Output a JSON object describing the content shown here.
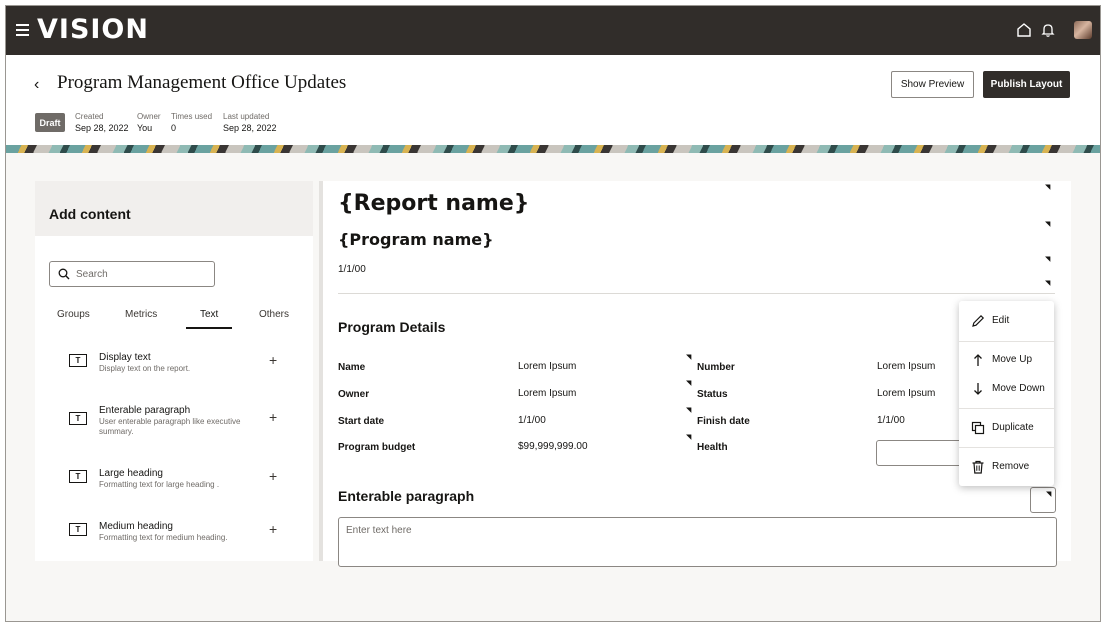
{
  "app": {
    "logo_text": "VISION"
  },
  "header": {
    "title": "Program Management Office Updates",
    "show_preview_label": "Show Preview",
    "publish_label": "Publish Layout",
    "status_badge": "Draft",
    "meta": [
      {
        "key": "Created",
        "value": "Sep 28, 2022"
      },
      {
        "key": "Owner",
        "value": "You"
      },
      {
        "key": "Times used",
        "value": "0"
      },
      {
        "key": "Last updated",
        "value": "Sep 28, 2022"
      }
    ]
  },
  "left_panel": {
    "title": "Add content",
    "search_placeholder": "Search",
    "tabs": [
      "Groups",
      "Metrics",
      "Text",
      "Others"
    ],
    "active_tab": "Text",
    "items": [
      {
        "title": "Display text",
        "desc": "Display text on the report."
      },
      {
        "title": "Enterable paragraph",
        "desc": "User enterable paragraph like executive summary."
      },
      {
        "title": "Large heading",
        "desc": "Formatting text for large heading ."
      },
      {
        "title": "Medium heading",
        "desc": "Formatting text for medium heading."
      }
    ]
  },
  "canvas": {
    "report_name": "{Report name}",
    "program_name": "{Program name}",
    "date": "1/1/00",
    "program_details_title": "Program Details",
    "fields": [
      {
        "label": "Name",
        "value": "Lorem Ipsum"
      },
      {
        "label": "Owner",
        "value": "Lorem Ipsum"
      },
      {
        "label": "Start date",
        "value": "1/1/00"
      },
      {
        "label": "Program budget",
        "value": "$99,999,999.00"
      },
      {
        "label": "Number",
        "value": "Lorem Ipsum"
      },
      {
        "label": "Status",
        "value": "Lorem Ipsum"
      },
      {
        "label": "Finish date",
        "value": "1/1/00"
      },
      {
        "label": "Health",
        "value": ""
      }
    ],
    "enterable_title": "Enterable paragraph",
    "textarea_placeholder": "Enter text here"
  },
  "context_menu": {
    "items": [
      "Edit",
      "Move Up",
      "Move Down",
      "Duplicate",
      "Remove"
    ]
  },
  "colors": {
    "topbar": "#312d2a",
    "publish": "#312d2a",
    "badge": "#6f6b67"
  },
  "icons": [
    "hamburger-icon",
    "home-icon",
    "bell-icon",
    "back-icon",
    "search-icon",
    "text-icon",
    "plus-icon",
    "pencil-icon",
    "arrow-up-icon",
    "arrow-down-icon",
    "duplicate-icon",
    "trash-icon"
  ]
}
